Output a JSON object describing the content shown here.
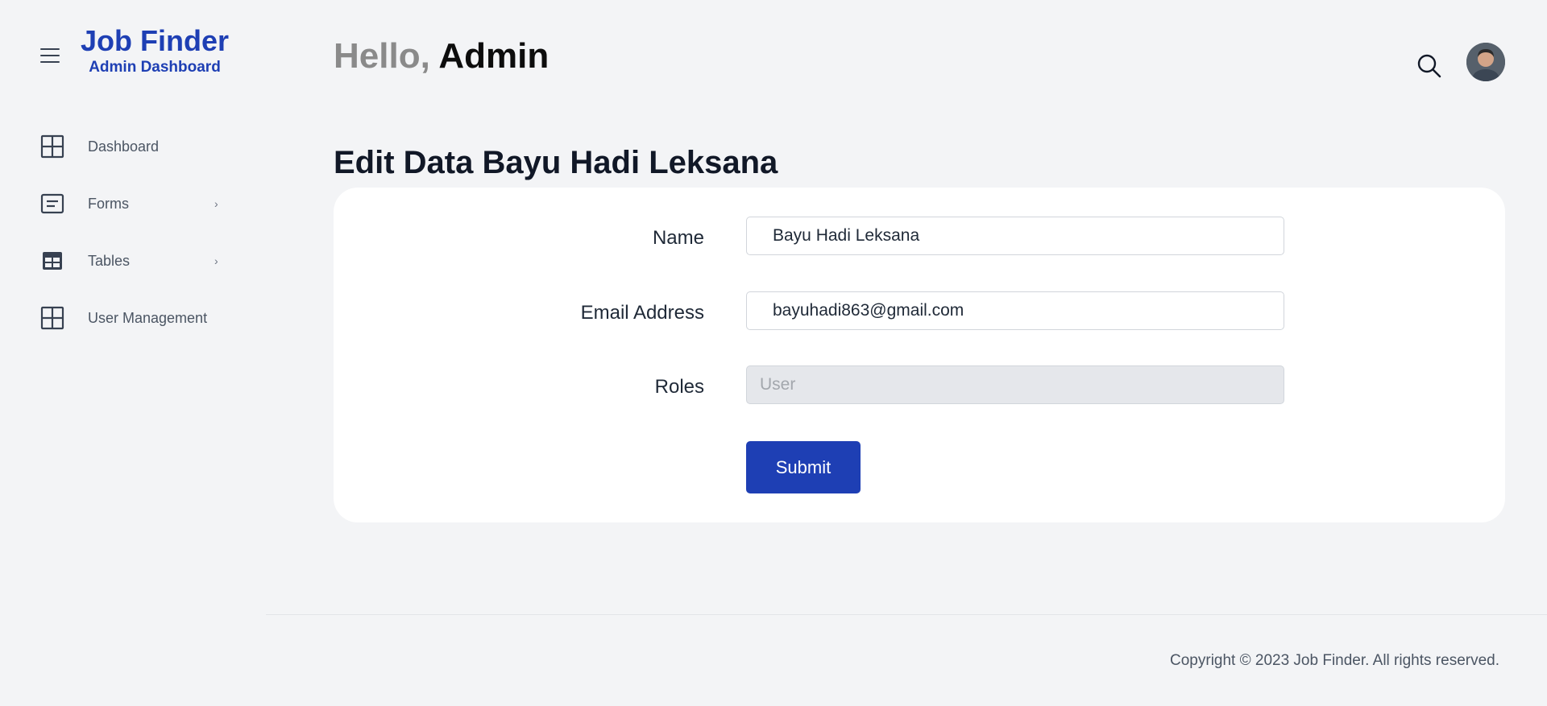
{
  "brand": {
    "title": "Job Finder",
    "subtitle": "Admin Dashboard",
    "color": "#1e3fb4"
  },
  "sidebar": {
    "items": [
      {
        "label": "Dashboard",
        "icon": "grid-icon",
        "has_submenu": false
      },
      {
        "label": "Forms",
        "icon": "form-icon",
        "has_submenu": true
      },
      {
        "label": "Tables",
        "icon": "table-icon",
        "has_submenu": true
      },
      {
        "label": "User Management",
        "icon": "grid-icon",
        "has_submenu": false
      }
    ],
    "chevron": "›"
  },
  "header": {
    "greeting_prefix": "Hello,",
    "greeting_name": "Admin",
    "search_icon": "search-icon",
    "avatar_icon": "user-avatar"
  },
  "main": {
    "page_title": "Edit Data Bayu Hadi Leksana",
    "form": {
      "name_label": "Name",
      "name_value": "Bayu Hadi Leksana",
      "email_label": "Email Address",
      "email_value": "bayuhadi863@gmail.com",
      "roles_label": "Roles",
      "roles_value": "User",
      "submit_label": "Submit"
    }
  },
  "footer": {
    "copyright": "Copyright © 2023 Job Finder. All rights reserved."
  }
}
